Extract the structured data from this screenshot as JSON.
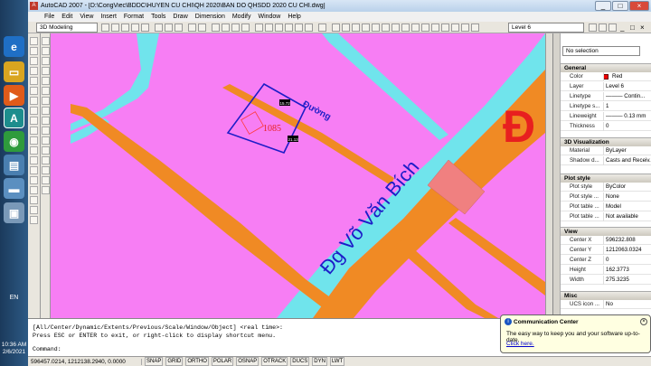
{
  "taskbar": {
    "language": "EN",
    "time": "10:36 AM",
    "date": "2/6/2021"
  },
  "titlebar": {
    "title": "AutoCAD 2007 - [D:\\CongViec\\BDDC\\HUYEN CU CHI\\QH 2020\\BAN DO QHSDD 2020 CU CHI.dwg]",
    "minimize": "_",
    "maximize": "□",
    "close": "×"
  },
  "menu": [
    "File",
    "Edit",
    "View",
    "Insert",
    "Format",
    "Tools",
    "Draw",
    "Dimension",
    "Modify",
    "Window",
    "Help"
  ],
  "toolbar": {
    "workspace": "3D Modeling",
    "layer": "Level 6"
  },
  "drawing": {
    "parcel_number": "1085",
    "parcel_area": "",
    "dim_top": "15.72",
    "dim_right": "21.13",
    "road_label": "Đường",
    "street_name": "Đg Võ Văn Bích",
    "big_letter": "Đ",
    "colors": {
      "background": "#f77ef4",
      "road_orange": "#f08a24",
      "river_cyan": "#70e4ec",
      "parcel_outline": "#1d1dc8",
      "salmon_block": "#f08080",
      "label_red": "#e81f1f"
    }
  },
  "properties": {
    "selection": "No selection",
    "general_title": "General",
    "general": [
      {
        "k": "Color",
        "v": "Red"
      },
      {
        "k": "Layer",
        "v": "Level 6"
      },
      {
        "k": "Linetype",
        "v": "——— Contin..."
      },
      {
        "k": "Linetype s...",
        "v": "1"
      },
      {
        "k": "Lineweight",
        "v": "——— 0.13 mm"
      },
      {
        "k": "Thickness",
        "v": "0"
      }
    ],
    "viz_title": "3D Visualization",
    "viz": [
      {
        "k": "Material",
        "v": "ByLayer"
      },
      {
        "k": "Shadow d...",
        "v": "Casts and Receiv..."
      }
    ],
    "plot_title": "Plot style",
    "plot": [
      {
        "k": "Plot style",
        "v": "ByColor"
      },
      {
        "k": "Plot style ...",
        "v": "None"
      },
      {
        "k": "Plot table ...",
        "v": "Model"
      },
      {
        "k": "Plot table ...",
        "v": "Not available"
      }
    ],
    "view_title": "View",
    "view": [
      {
        "k": "Center X",
        "v": "596232.808"
      },
      {
        "k": "Center Y",
        "v": "1212063.0324"
      },
      {
        "k": "Center Z",
        "v": "0"
      },
      {
        "k": "Height",
        "v": "162.3773"
      },
      {
        "k": "Width",
        "v": "275.3235"
      }
    ],
    "misc_title": "Misc",
    "misc": [
      {
        "k": "UCS icon ...",
        "v": "No"
      }
    ]
  },
  "command": {
    "line1": "[All/Center/Dynamic/Extents/Previous/Scale/Window/Object] <real time>:",
    "line2": "Press ESC or ENTER to exit, or right-click to display shortcut menu.",
    "prompt": "Command:"
  },
  "status": {
    "coords": "596457.0214, 1212138.2940, 0.0000",
    "buttons": [
      "SNAP",
      "GRID",
      "ORTHO",
      "POLAR",
      "OSNAP",
      "OTRACK",
      "DUCS",
      "DYN",
      "LWT"
    ]
  },
  "balloon": {
    "title": "Communication Center",
    "body": "The easy way to keep you and your software up-to-date.",
    "link": "Click here."
  }
}
